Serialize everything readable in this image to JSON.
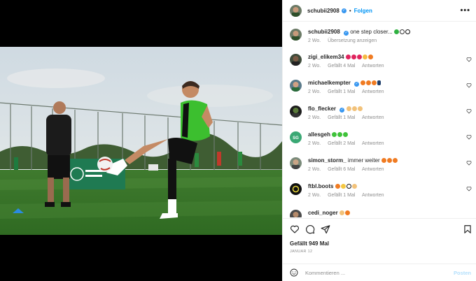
{
  "header": {
    "username": "schubii2908",
    "follow_label": "Folgen",
    "separator": "•",
    "more_label": "•••"
  },
  "caption": {
    "username": "schubii2908",
    "text": "one step closer...",
    "emoji": [
      "green-circle",
      "white-circle",
      "soccer-ball"
    ],
    "time": "2 Wo.",
    "translate_label": "Übersetzung anzeigen"
  },
  "comments": [
    {
      "username": "zigi_elikem34",
      "verified": false,
      "text": "",
      "emoji": [
        "red-heart",
        "red-heart",
        "red-heart",
        "clapping-hands",
        "fire"
      ],
      "time": "2 Wo.",
      "likes": "Gefällt 4 Mal",
      "reply": "Antworten"
    },
    {
      "username": "michaelkempter",
      "verified": true,
      "text": "",
      "emoji": [
        "fire",
        "fire",
        "fire",
        "bottle"
      ],
      "time": "2 Wo.",
      "likes": "Gefällt 1 Mal",
      "reply": "Antworten"
    },
    {
      "username": "flo_flecker",
      "verified": true,
      "text": "",
      "emoji": [
        "flexed-biceps",
        "flexed-biceps",
        "flexed-biceps"
      ],
      "time": "2 Wo.",
      "likes": "Gefällt 1 Mal",
      "reply": "Antworten"
    },
    {
      "username": "allesgeh",
      "verified": false,
      "text": "",
      "emoji": [
        "green-heart",
        "green-heart",
        "green-heart"
      ],
      "time": "2 Wo.",
      "likes": "Gefällt 2 Mal",
      "reply": "Antworten"
    },
    {
      "username": "simon_storm_",
      "verified": false,
      "text": "immer weiter",
      "emoji": [
        "fire",
        "fire",
        "fire"
      ],
      "time": "2 Wo.",
      "likes": "Gefällt 6 Mal",
      "reply": "Antworten"
    },
    {
      "username": "ftbl.boots",
      "verified": false,
      "text": "",
      "emoji": [
        "fire",
        "heart-eyes",
        "soccer-ball",
        "flexed-biceps"
      ],
      "time": "2 Wo.",
      "likes": "Gefällt 1 Mal",
      "reply": "Antworten"
    },
    {
      "username": "cedi_noger",
      "verified": false,
      "text": "",
      "emoji": [
        "flexed-biceps",
        "fire"
      ],
      "time": "",
      "likes": "",
      "reply": ""
    }
  ],
  "actions": {
    "like_icon": "heart-outline-icon",
    "comment_icon": "comment-icon",
    "share_icon": "paper-plane-icon",
    "save_icon": "bookmark-icon"
  },
  "likes_total": "Gefällt 949 Mal",
  "post_date": "JANUAR 12",
  "comment_box": {
    "placeholder": "Kommentieren ...",
    "post_label": "Posten"
  },
  "colors": {
    "accent_blue": "#0095f6",
    "verified_blue": "#3897f0",
    "muted_text": "#8e8e8e",
    "post_disabled": "#b2dffc"
  }
}
